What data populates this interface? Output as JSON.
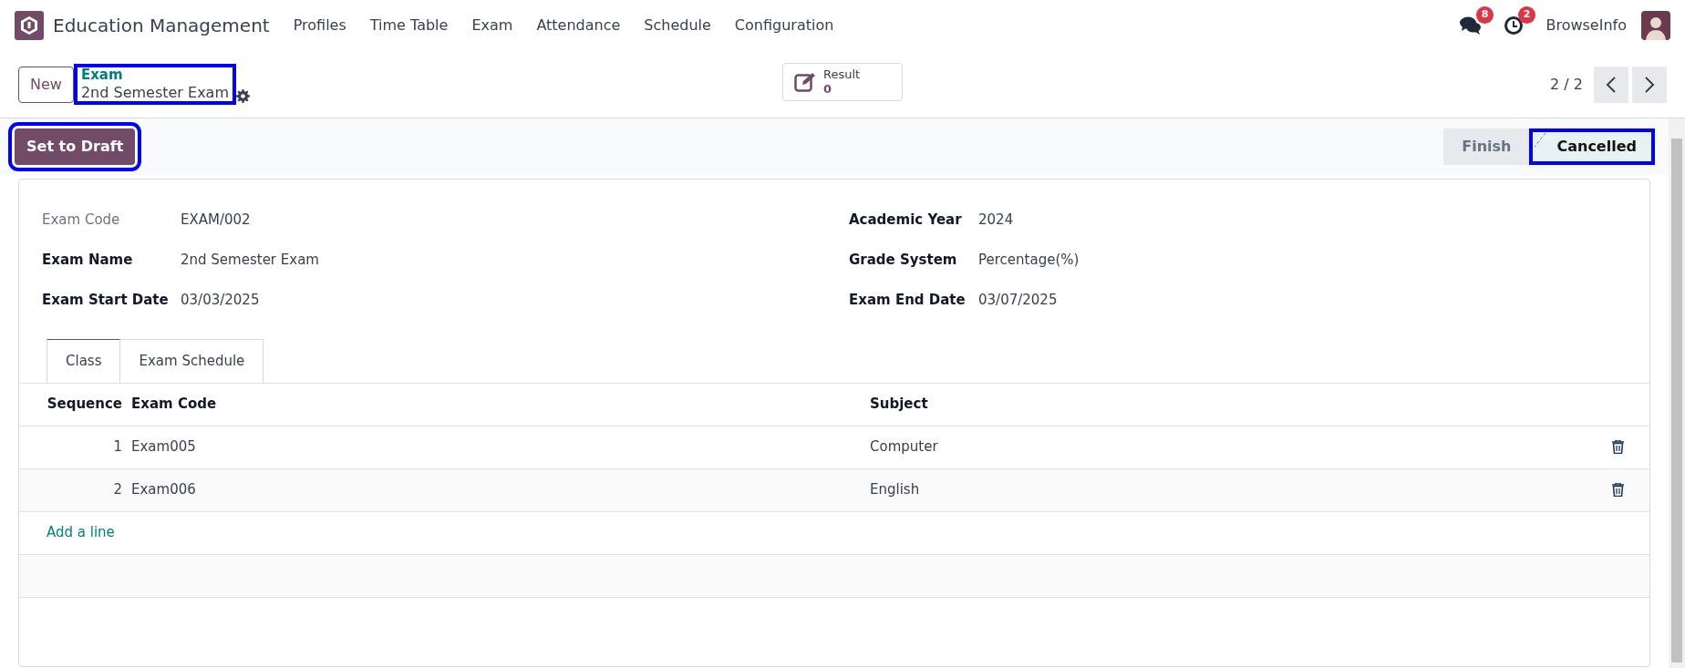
{
  "app": {
    "title": "Education Management",
    "menu": [
      "Profiles",
      "Time Table",
      "Exam",
      "Attendance",
      "Schedule",
      "Configuration"
    ]
  },
  "systray": {
    "messages_count": "8",
    "activities_count": "2",
    "user": "BrowseInfo"
  },
  "control_panel": {
    "new_button": "New",
    "breadcrumb": "Exam",
    "record_title": "2nd Semester Exam",
    "title_highlighted": true,
    "smart_button": {
      "label": "Result",
      "value": "0"
    },
    "pager": "2 / 2"
  },
  "status_bar": {
    "action_button": "Set to Draft",
    "action_highlighted": true,
    "stages": [
      {
        "label": "Finish",
        "selected": false,
        "highlighted": false
      },
      {
        "label": "Cancelled",
        "selected": true,
        "highlighted": true
      }
    ]
  },
  "form": {
    "left_fields": [
      {
        "label": "Exam Code",
        "value": "EXAM/002",
        "required": false
      },
      {
        "label": "Exam Name",
        "value": "2nd Semester Exam",
        "required": true
      },
      {
        "label": "Exam Start Date",
        "value": "03/03/2025",
        "required": true
      }
    ],
    "right_fields": [
      {
        "label": "Academic Year",
        "value": "2024",
        "required": true
      },
      {
        "label": "Grade System",
        "value": "Percentage(%)",
        "required": true
      },
      {
        "label": "Exam End Date",
        "value": "03/07/2025",
        "required": true
      }
    ]
  },
  "tabs": [
    {
      "label": "Class",
      "selected": true
    },
    {
      "label": "Exam Schedule",
      "selected": false
    }
  ],
  "table": {
    "columns": [
      "Sequence",
      "Exam Code",
      "Subject"
    ],
    "rows": [
      [
        "1",
        "Exam005",
        "Computer"
      ],
      [
        "2",
        "Exam006",
        "English"
      ]
    ],
    "add_line": "Add a line"
  }
}
